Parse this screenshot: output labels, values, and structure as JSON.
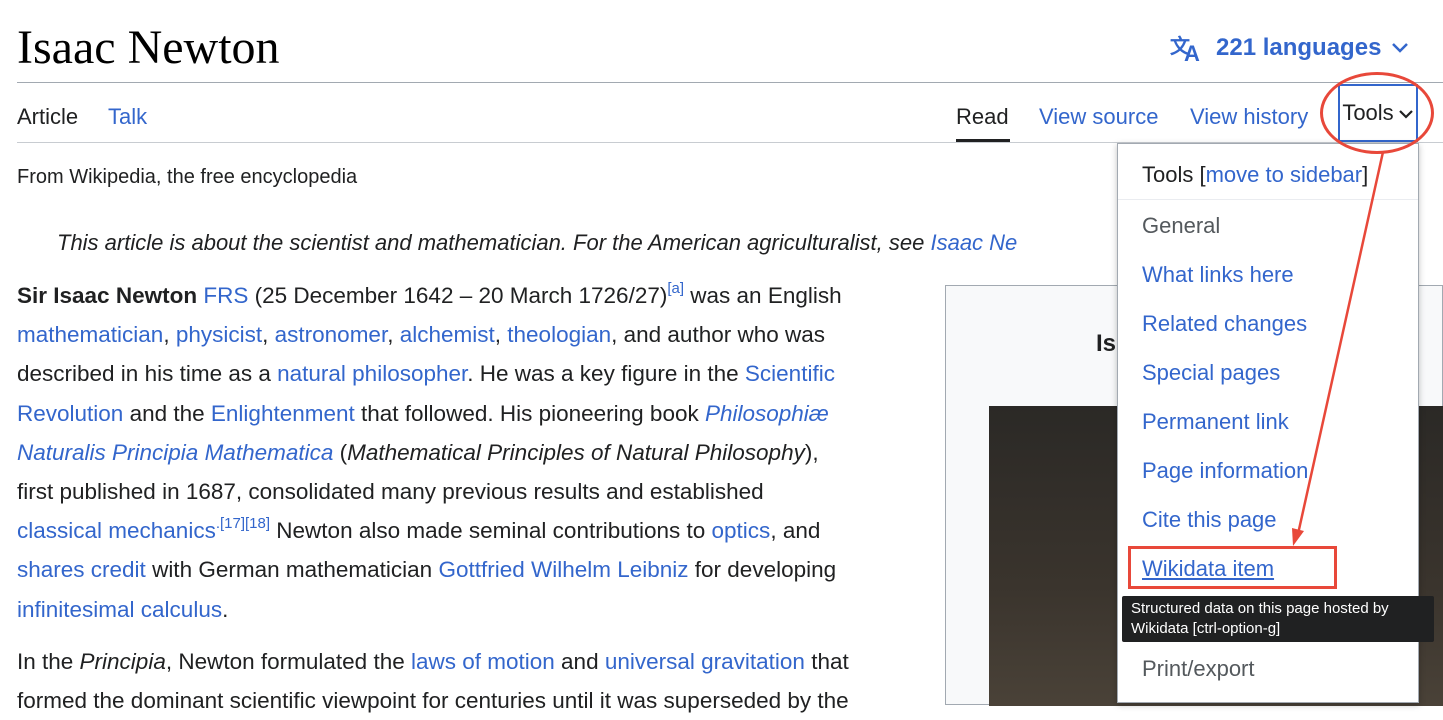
{
  "page": {
    "title": "Isaac Newton",
    "languages_label": "221 languages"
  },
  "tabs": {
    "article": "Article",
    "talk": "Talk",
    "read": "Read",
    "view_source": "View source",
    "view_history": "View history",
    "tools": "Tools"
  },
  "tagline": "From Wikipedia, the free encyclopedia",
  "hatnote": {
    "text": "This article is about the scientist and mathematician. For the American agriculturalist, see ",
    "link": "Isaac Ne"
  },
  "lead": {
    "l1_bold": "Sir Isaac Newton",
    "l1_frs": "FRS",
    "l1_dates": " (25 December 1642 – 20 March 1726/27)",
    "l1_note": "[a]",
    "l1_rest": " was an English",
    "mathematician": "mathematician",
    "physicist": "physicist",
    "astronomer": "astronomer",
    "alchemist": "alchemist",
    "theologian": "theologian",
    "l2_rest": ", and author who was",
    "l3_a": "described in his time as a ",
    "natural_philosopher": "natural philosopher",
    "l3_b": ". He was a key figure in the ",
    "scientific": "Scientific",
    "revolution": "Revolution",
    "l4_a": " and the ",
    "enlightenment": "Enlightenment",
    "l4_b": " that followed. His pioneering book ",
    "principia1": "Philosophiæ",
    "principia2": "Naturalis Principia Mathematica",
    "l5_a": " (",
    "l5_it": "Mathematical Principles of Natural Philosophy",
    "l5_b": "),",
    "l6": "first published in 1687, consolidated many previous results and established",
    "classical_mechanics": "classical mechanics",
    "l7_note": ".[17][18]",
    "l7_a": " Newton also made seminal contributions to ",
    "optics": "optics",
    "l7_b": ", and",
    "shares_credit": "shares credit",
    "l8_a": " with German mathematician ",
    "leibniz": "Gottfried Wilhelm Leibniz",
    "l8_b": " for developing",
    "calculus": "infinitesimal calculus",
    "l9": "."
  },
  "para2": {
    "a": "In the ",
    "it": "Principia",
    "b": ", Newton formulated the ",
    "laws": "laws of motion",
    "c": " and ",
    "gravitation": "universal gravitation",
    "d": " that",
    "e": "formed the dominant scientific viewpoint for centuries until it was superseded by the"
  },
  "infobox": {
    "title_fragment": "Is"
  },
  "tools_menu": {
    "header": "Tools",
    "move_link": "move to sidebar",
    "section_general": "General",
    "items": [
      "What links here",
      "Related changes",
      "Special pages",
      "Permanent link",
      "Page information",
      "Cite this page",
      "Wikidata item"
    ],
    "section_print": "Print/export"
  },
  "tooltip": {
    "line1": "Structured data on this page hosted by",
    "line2": "Wikidata [ctrl-option-g]"
  },
  "colors": {
    "link": "#3366cc",
    "annotation": "#e8483a",
    "text": "#202122"
  }
}
